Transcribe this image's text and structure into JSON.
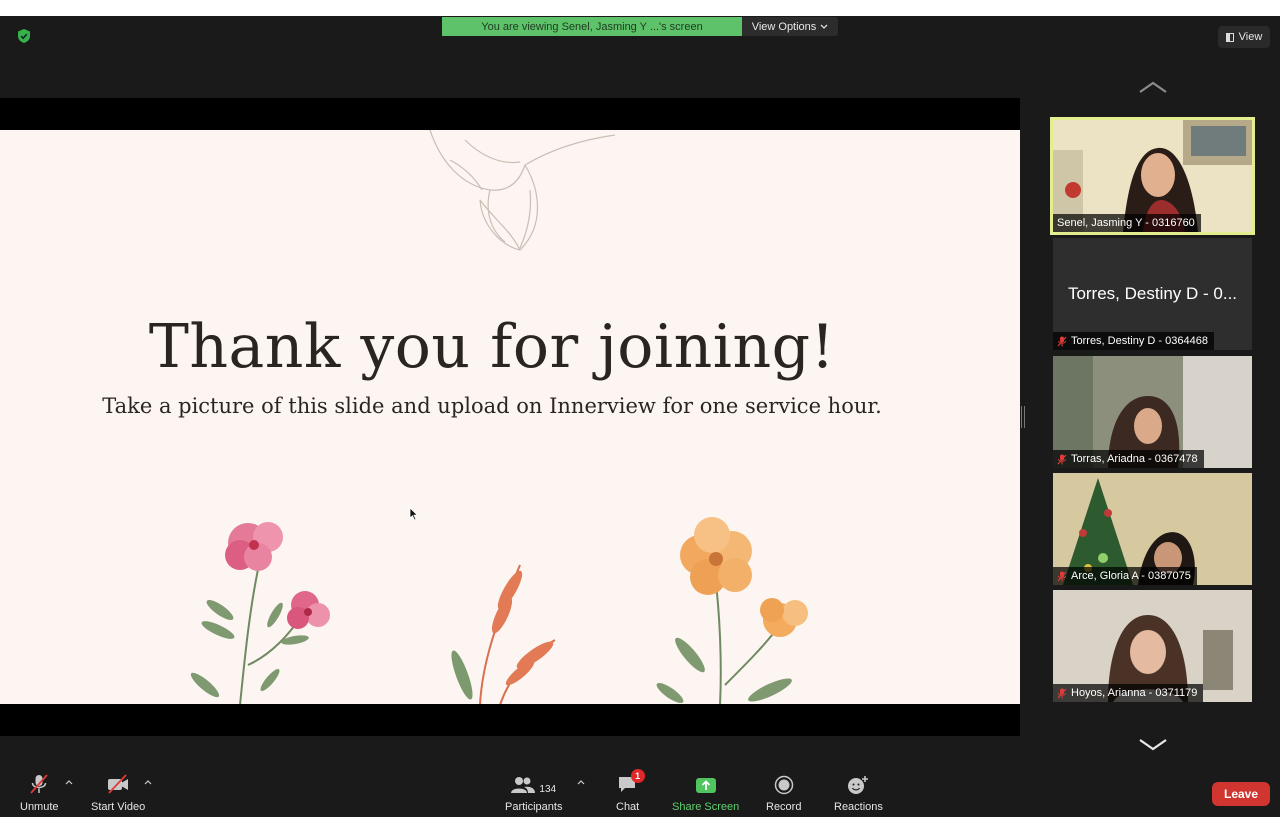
{
  "banner": {
    "viewing_text": "You are viewing Senel, Jasming Y ...'s screen",
    "view_options": "View Options"
  },
  "view_button": "View",
  "slide": {
    "title": "Thank you for joining!",
    "subtitle": "Take a picture of this slide and upload on Innerview for one service hour."
  },
  "participants_panel": {
    "tiles": [
      {
        "name": "Senel, Jasming Y - 0316760",
        "muted": false,
        "active": true
      },
      {
        "name": "Torres, Destiny D - 0364468",
        "big_name": "Torres, Destiny D - 0...",
        "muted": true,
        "active": false
      },
      {
        "name": "Torras, Ariadna - 0367478",
        "muted": true,
        "active": false
      },
      {
        "name": "Arce, Gloria A - 0387075",
        "muted": true,
        "active": false
      },
      {
        "name": "Hoyos, Arianna - 0371179",
        "muted": true,
        "active": false
      }
    ]
  },
  "toolbar": {
    "unmute": "Unmute",
    "start_video": "Start Video",
    "participants": "Participants",
    "participant_count": "134",
    "chat": "Chat",
    "chat_badge": "1",
    "share_screen": "Share Screen",
    "record": "Record",
    "reactions": "Reactions",
    "leave": "Leave"
  },
  "colors": {
    "share_green": "#5ed16d",
    "banner_green": "#5ec26a",
    "leave_red": "#d0352f",
    "active_outline": "#e4ee8f"
  }
}
